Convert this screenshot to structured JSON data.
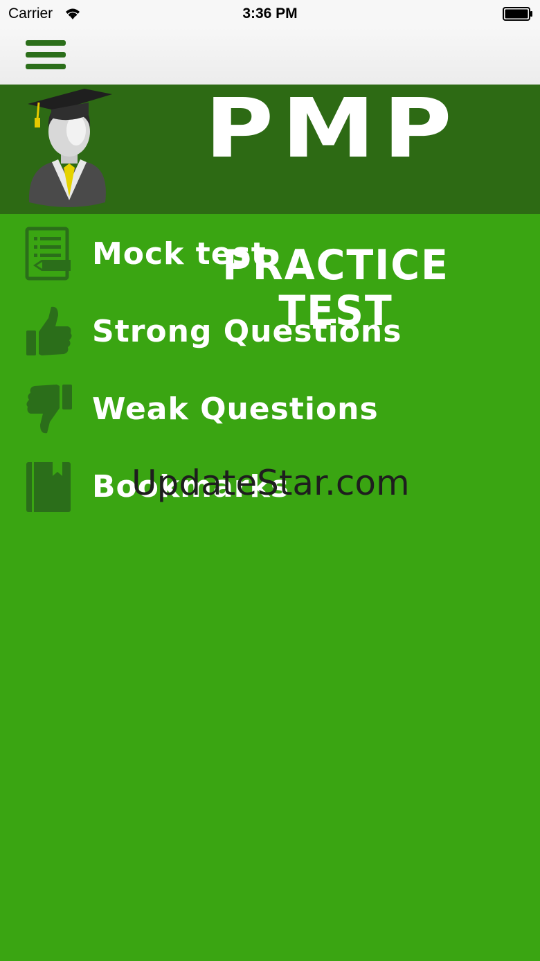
{
  "status_bar": {
    "carrier": "Carrier",
    "time": "3:36 PM"
  },
  "nav": {
    "menu_icon": "hamburger-menu-icon"
  },
  "banner": {
    "title": "PMP",
    "subtitle": "PRACTICE TEST"
  },
  "menu": {
    "items": [
      {
        "label": "Mock test",
        "icon": "test-sheet-icon"
      },
      {
        "label": "Strong Questions",
        "icon": "thumbs-up-icon"
      },
      {
        "label": "Weak Questions",
        "icon": "thumbs-down-icon"
      },
      {
        "label": "Bookmarks",
        "icon": "bookmark-book-icon"
      }
    ]
  },
  "watermark": "UpdateStar.com",
  "colors": {
    "background": "#3aa512",
    "banner": "#2d6a14",
    "icon": "#2b6e1a",
    "text": "#ffffff"
  }
}
